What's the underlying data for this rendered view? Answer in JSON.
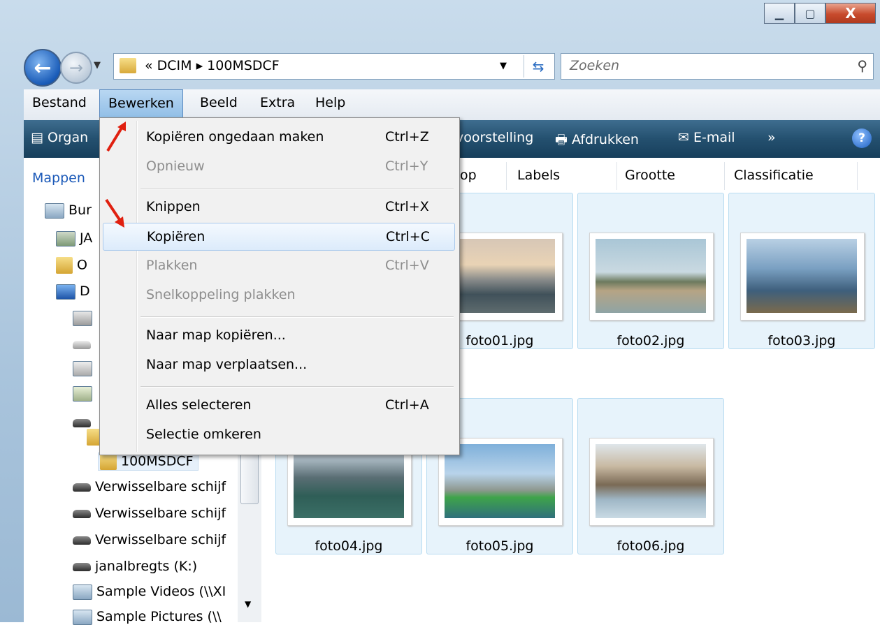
{
  "address": {
    "path": "« DCIM ▸ 100MSDCF"
  },
  "search": {
    "placeholder": "Zoeken"
  },
  "menubar": {
    "items": [
      "Bestand",
      "Bewerken",
      "Beeld",
      "Extra",
      "Help"
    ]
  },
  "toolbar": {
    "organize": "Organ",
    "slideshow": "voorstelling",
    "print": "Afdrukken",
    "email": "E-mail",
    "more": "»"
  },
  "leftpane": {
    "title": "Mappen",
    "tree": [
      "Bur",
      "JA",
      "O",
      "D",
      "100MSDCF",
      "Verwisselbare schijf",
      "Verwisselbare schijf",
      "Verwisselbare schijf",
      "janalbregts (K:)",
      "Sample Videos (\\\\XI",
      "Sample Pictures (\\\\"
    ]
  },
  "columns": [
    "op",
    "Labels",
    "Grootte",
    "Classificatie"
  ],
  "files": [
    "foto01.jpg",
    "foto02.jpg",
    "foto03.jpg",
    "foto04.jpg",
    "foto05.jpg",
    "foto06.jpg"
  ],
  "editmenu": {
    "items": [
      {
        "label": "Kopiëren ongedaan maken",
        "shortcut": "Ctrl+Z",
        "enabled": true
      },
      {
        "label": "Opnieuw",
        "shortcut": "Ctrl+Y",
        "enabled": false
      },
      {
        "label": "Knippen",
        "shortcut": "Ctrl+X",
        "enabled": true
      },
      {
        "label": "Kopiëren",
        "shortcut": "Ctrl+C",
        "enabled": true,
        "highlighted": true
      },
      {
        "label": "Plakken",
        "shortcut": "Ctrl+V",
        "enabled": false
      },
      {
        "label": "Snelkoppeling plakken",
        "shortcut": "",
        "enabled": false
      },
      {
        "label": "Naar map kopiëren...",
        "shortcut": "",
        "enabled": true
      },
      {
        "label": "Naar map verplaatsen...",
        "shortcut": "",
        "enabled": true
      },
      {
        "label": "Alles selecteren",
        "shortcut": "Ctrl+A",
        "enabled": true
      },
      {
        "label": "Selectie omkeren",
        "shortcut": "",
        "enabled": true
      }
    ]
  },
  "colors": {
    "toolbar": "#24506f",
    "menu_highlight": "#dcebfb",
    "tile": "#e7f3fb",
    "arrow": "#e02010"
  }
}
